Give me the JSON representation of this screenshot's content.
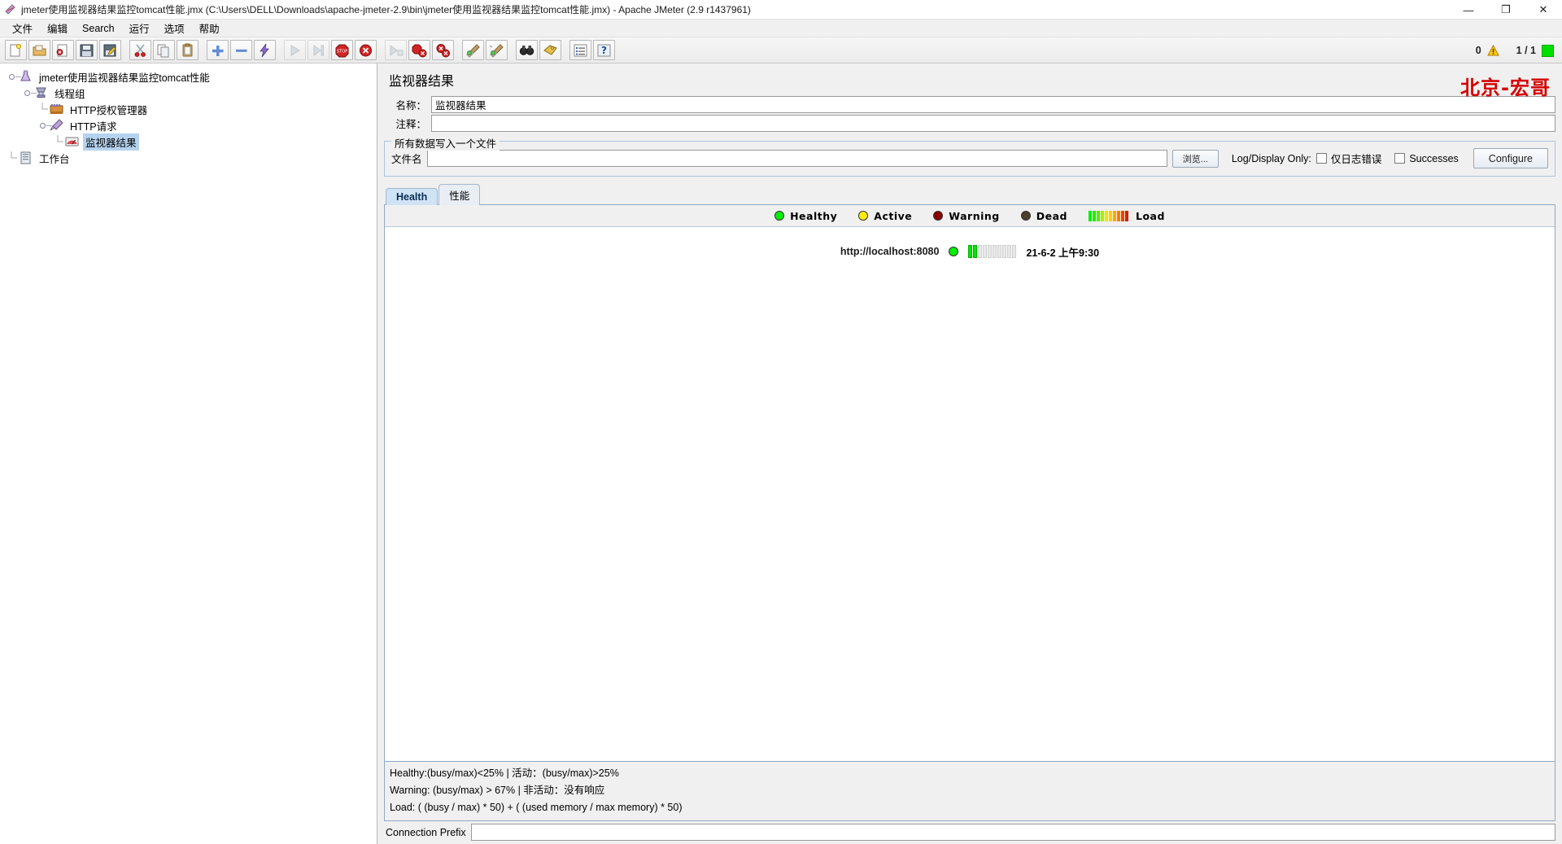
{
  "window": {
    "title": "jmeter使用监视器结果监控tomcat性能.jmx (C:\\Users\\DELL\\Downloads\\apache-jmeter-2.9\\bin\\jmeter使用监视器结果监控tomcat性能.jmx) - Apache JMeter (2.9 r1437961)",
    "minimize_label": "—",
    "maximize_label": "❐",
    "close_label": "✕",
    "app_icon": "jmeter-feather-icon"
  },
  "menubar": {
    "items": [
      {
        "label": "文件",
        "name": "menu-file"
      },
      {
        "label": "编辑",
        "name": "menu-edit"
      },
      {
        "label": "Search",
        "name": "menu-search"
      },
      {
        "label": "运行",
        "name": "menu-run"
      },
      {
        "label": "选项",
        "name": "menu-options"
      },
      {
        "label": "帮助",
        "name": "menu-help"
      }
    ]
  },
  "toolbar": {
    "buttons": [
      {
        "name": "new-button",
        "icon": "new-document-icon",
        "disabled": false,
        "group_end": false
      },
      {
        "name": "templates-button",
        "icon": "open-folder-icon",
        "disabled": false,
        "group_end": false
      },
      {
        "name": "open-button",
        "icon": "close-document-icon",
        "disabled": false,
        "group_end": false
      },
      {
        "name": "save-button",
        "icon": "floppy-save-icon",
        "disabled": false,
        "group_end": false
      },
      {
        "name": "save-as-button",
        "icon": "save-as-pencil-icon",
        "disabled": false,
        "group_end": true
      },
      {
        "name": "cut-button",
        "icon": "scissors-icon",
        "disabled": false,
        "group_end": false
      },
      {
        "name": "copy-button",
        "icon": "copy-pages-icon",
        "disabled": false,
        "group_end": false
      },
      {
        "name": "paste-button",
        "icon": "clipboard-icon",
        "disabled": false,
        "group_end": true
      },
      {
        "name": "expand-all-button",
        "icon": "plus-icon",
        "disabled": false,
        "group_end": false
      },
      {
        "name": "collapse-all-button",
        "icon": "minus-icon",
        "disabled": false,
        "group_end": false
      },
      {
        "name": "toggle-button",
        "icon": "lightning-bolt-icon",
        "disabled": false,
        "group_end": true
      },
      {
        "name": "start-button",
        "icon": "play-icon",
        "disabled": true,
        "group_end": false
      },
      {
        "name": "start-no-pause-button",
        "icon": "play-no-pause-icon",
        "disabled": true,
        "group_end": false
      },
      {
        "name": "stop-button",
        "icon": "stop-sign-icon",
        "disabled": false,
        "group_end": false
      },
      {
        "name": "shutdown-button",
        "icon": "shutdown-x-icon",
        "disabled": false,
        "group_end": true
      },
      {
        "name": "start-remote-button",
        "icon": "remote-play-icon",
        "disabled": true,
        "group_end": false
      },
      {
        "name": "stop-remote-button",
        "icon": "remote-stop-icon",
        "disabled": false,
        "group_end": false
      },
      {
        "name": "shutdown-remote-button",
        "icon": "remote-shutdown-icon",
        "disabled": false,
        "group_end": true
      },
      {
        "name": "clear-button",
        "icon": "broom-clear-icon",
        "disabled": false,
        "group_end": false
      },
      {
        "name": "clear-all-button",
        "icon": "broom-clear-all-icon",
        "disabled": false,
        "group_end": true
      },
      {
        "name": "search-button",
        "icon": "binoculars-icon",
        "disabled": false,
        "group_end": false
      },
      {
        "name": "search-reset-button",
        "icon": "tag-reset-icon",
        "disabled": false,
        "group_end": true
      },
      {
        "name": "function-helper-button",
        "icon": "list-lines-icon",
        "disabled": false,
        "group_end": false
      },
      {
        "name": "help-button",
        "icon": "question-help-icon",
        "disabled": false,
        "group_end": false
      }
    ],
    "status": {
      "warning_count": "0",
      "warning_icon": "warning-triangle-icon",
      "thread_counter": "1 / 1",
      "running_indicator": "running-green-box"
    }
  },
  "tree": {
    "nodes": [
      {
        "label": "jmeter使用监视器结果监控tomcat性能",
        "icon": "test-plan-icon",
        "depth": 0,
        "expander": true,
        "selected": false,
        "name": "tree-node-test-plan"
      },
      {
        "label": "线程组",
        "icon": "thread-group-icon",
        "depth": 1,
        "expander": true,
        "selected": false,
        "name": "tree-node-thread-group"
      },
      {
        "label": "HTTP授权管理器",
        "icon": "auth-manager-icon",
        "depth": 2,
        "expander": false,
        "selected": false,
        "name": "tree-node-http-auth-manager"
      },
      {
        "label": "HTTP请求",
        "icon": "http-request-icon",
        "depth": 2,
        "expander": true,
        "selected": false,
        "name": "tree-node-http-request"
      },
      {
        "label": "监视器结果",
        "icon": "monitor-results-icon",
        "depth": 3,
        "expander": false,
        "selected": true,
        "name": "tree-node-monitor-results"
      },
      {
        "label": "工作台",
        "icon": "workbench-icon",
        "depth": 0,
        "expander": false,
        "selected": false,
        "name": "tree-node-workbench"
      }
    ]
  },
  "editor": {
    "brand_watermark": "北京-宏哥",
    "panel_title": "监视器结果",
    "name_label": "名称：",
    "name_value": "监视器结果",
    "comment_label": "注释：",
    "comment_value": "",
    "filegroup": {
      "title": "所有数据写入一个文件",
      "filename_label": "文件名",
      "filename_value": "",
      "browse_label": "浏览...",
      "logdisplay_label": "Log/Display Only:",
      "errors_only_label": "仅日志错误",
      "errors_only_checked": false,
      "successes_label": "Successes",
      "successes_checked": false,
      "configure_label": "Configure"
    },
    "tabs": [
      {
        "label": "Health",
        "active": true,
        "name": "tab-health"
      },
      {
        "label": "性能",
        "active": false,
        "name": "tab-performance"
      }
    ],
    "legend": [
      {
        "label": "Healthy",
        "color": "#00ee00",
        "name": "legend-healthy"
      },
      {
        "label": "Active",
        "color": "#ffee00",
        "name": "legend-active"
      },
      {
        "label": "Warning",
        "color": "#8b0000",
        "name": "legend-warning"
      },
      {
        "label": "Dead",
        "color": "#4d3d2d",
        "name": "legend-dead"
      }
    ],
    "load_label": "Load",
    "load_gradient": [
      "#00ee00",
      "#22ee00",
      "#55ee00",
      "#aaee00",
      "#e8e800",
      "#ffd000",
      "#ffa800",
      "#ff7a00",
      "#ee4400",
      "#cc2200"
    ],
    "servers": [
      {
        "url": "http://localhost:8080",
        "status_color": "#00ee00",
        "status_name": "healthy",
        "load_filled": 2,
        "load_total": 10,
        "timestamp": "21-6-2 上午9:30",
        "name": "server-row-localhost-8080"
      }
    ],
    "info_lines": [
      "Healthy:(busy/max)<25%  |  活动：(busy/max)>25%",
      "Warning: (busy/max) > 67%  |  非活动：没有响应",
      "Load: ( (busy / max) * 50) + ( (used memory / max memory) * 50)"
    ],
    "connection_prefix_label": "Connection Prefix",
    "connection_prefix_value": ""
  }
}
